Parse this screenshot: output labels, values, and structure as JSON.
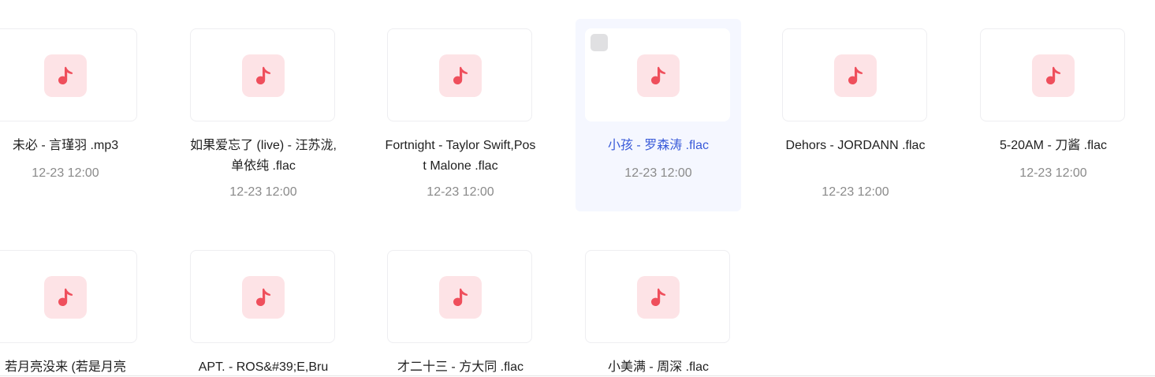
{
  "colors": {
    "selected_background": "#f5f7ff",
    "selected_text": "#3a5bd9",
    "music_tile_background": "#fde3e6",
    "music_note": "#ef4f5c"
  },
  "icons": {
    "file_type": "music-note-icon"
  },
  "files": [
    {
      "name": "未必 - 言瑾羽 .mp3",
      "date": "12-23 12:00",
      "selected": false
    },
    {
      "name": "如果爱忘了 (live) - 汪苏泷,单依纯 .flac",
      "date": "12-23 12:00",
      "selected": false
    },
    {
      "name": "Fortnight - Taylor Swift,Post Malone .flac",
      "date": "12-23 12:00",
      "selected": false
    },
    {
      "name": "小孩 - 罗森涛 .flac",
      "date": "12-23 12:00",
      "selected": true
    },
    {
      "name": "Dehors - JORDANN .flac",
      "date": "12-23 12:00",
      "selected": false
    },
    {
      "name": "5-20AM - 刀酱 .flac",
      "date": "12-23 12:00",
      "selected": false
    },
    {
      "name": "若月亮没来 (若是月亮",
      "date": "",
      "selected": false
    },
    {
      "name": "APT. - ROS&#39;E,Bru",
      "date": "",
      "selected": false
    },
    {
      "name": "才二十三 - 方大同 .flac",
      "date": "",
      "selected": false
    },
    {
      "name": "小美满 - 周深 .flac",
      "date": "",
      "selected": false
    }
  ]
}
